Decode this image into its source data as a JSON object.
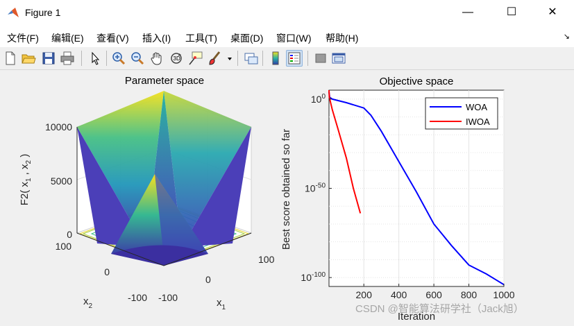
{
  "window": {
    "title": "Figure 1",
    "minimize": "—",
    "maximize": "☐",
    "close": "✕"
  },
  "menu": {
    "items": [
      "文件(F)",
      "编辑(E)",
      "查看(V)",
      "插入(I)",
      "工具(T)",
      "桌面(D)",
      "窗口(W)",
      "帮助(H)"
    ],
    "extra": "↘"
  },
  "toolbar": {
    "icons": [
      "new-figure-icon",
      "open-file-icon",
      "save-icon",
      "print-icon",
      "pointer-icon",
      "zoom-in-icon",
      "zoom-out-icon",
      "pan-hand-icon",
      "rotate-3d-icon",
      "data-cursor-icon",
      "brush-icon",
      "link-plot-icon",
      "colorbar-icon",
      "legend-icon",
      "hide-plot-tools-icon",
      "show-plot-tools-icon"
    ]
  },
  "left_plot": {
    "title": "Parameter space",
    "zlabel": "F2( x",
    "zlabel_sub1": "1",
    "zlabel_mid": " , x",
    "zlabel_sub2": "2",
    "zlabel_end": " )",
    "z_ticks": [
      "0",
      "5000",
      "10000"
    ],
    "x1_ticks": [
      "-100",
      "0",
      "100"
    ],
    "x2_ticks": [
      "100",
      "0",
      "-100"
    ],
    "x1_label": "x",
    "x1_label_sub": "1",
    "x2_label": "x",
    "x2_label_sub": "2",
    "colors": {
      "low": "#3b2fa0",
      "mid": "#20a3b5",
      "high": "#f5e11c"
    }
  },
  "chart_data": {
    "type": "line",
    "title": "Objective space",
    "xlabel": "Iteration",
    "ylabel": "Best score obtained so far",
    "xlim": [
      1,
      1000
    ],
    "ylim_log10": [
      -105,
      5
    ],
    "yscale": "log",
    "grid": true,
    "legend_position": "top-right",
    "x_ticks": [
      "200",
      "400",
      "600",
      "800",
      "1000"
    ],
    "y_ticks": [
      {
        "base": "10",
        "exp": "0"
      },
      {
        "base": "10",
        "exp": "-50"
      },
      {
        "base": "10",
        "exp": "-100"
      }
    ],
    "series": [
      {
        "name": "WOA",
        "color": "#0000ff",
        "x": [
          1,
          5,
          20,
          100,
          200,
          240,
          300,
          400,
          500,
          600,
          700,
          800,
          900,
          950,
          1000
        ],
        "log10_y": [
          4,
          1,
          0,
          -2,
          -5,
          -9,
          -18,
          -35,
          -52,
          -70,
          -82,
          -93,
          -98,
          -101,
          -104
        ]
      },
      {
        "name": "IWOA",
        "color": "#ff0000",
        "x": [
          1,
          3,
          20,
          50,
          100,
          140,
          180
        ],
        "log10_y": [
          5,
          1,
          -6,
          -16,
          -33,
          -50,
          -64
        ]
      }
    ]
  },
  "watermark": "CSDN @智能算法研学社（Jack旭）"
}
